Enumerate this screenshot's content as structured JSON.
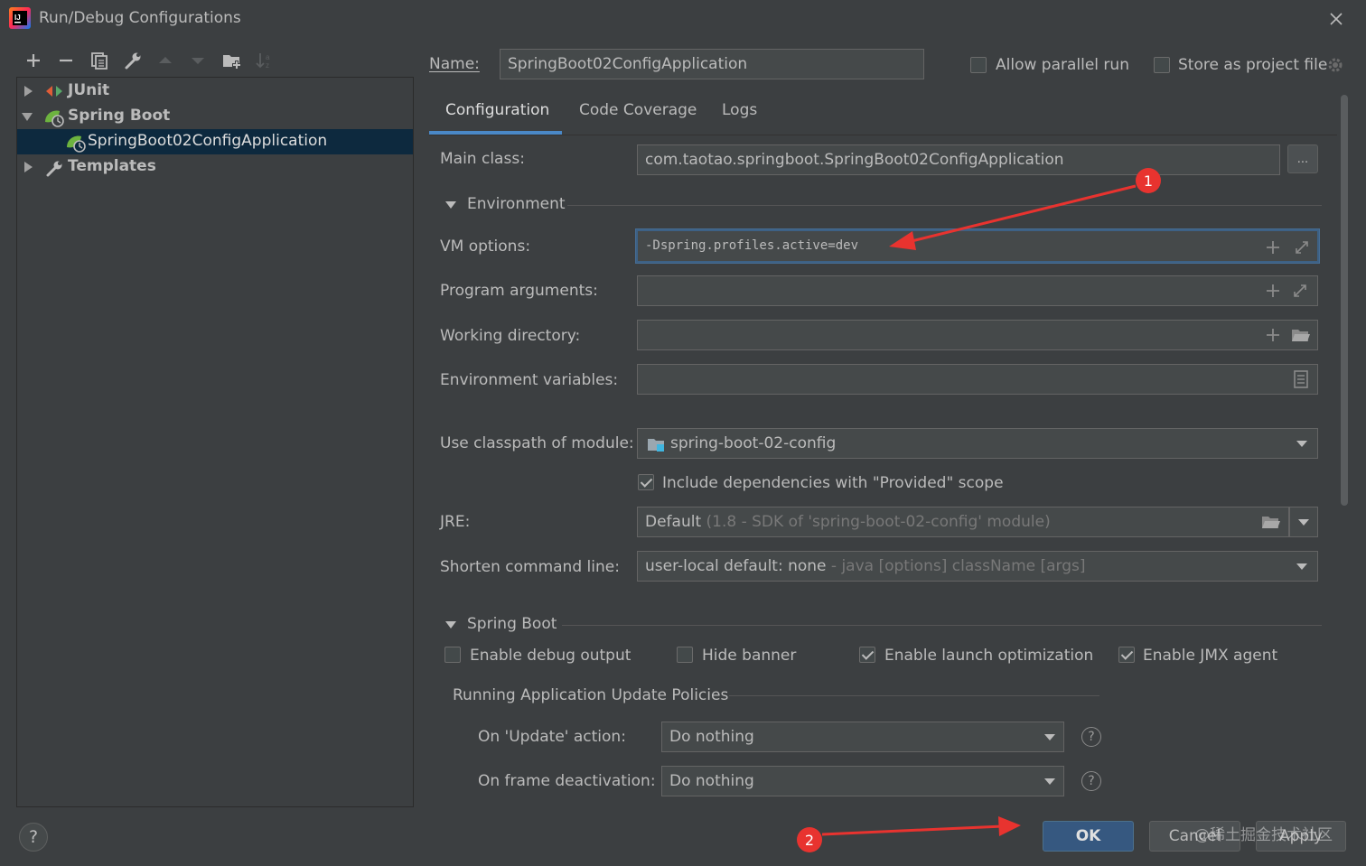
{
  "window": {
    "title": "Run/Debug Configurations"
  },
  "toolbar": {
    "icons": [
      "add-icon",
      "remove-icon",
      "copy-icon",
      "wrench-icon",
      "move-up-icon",
      "move-down-icon",
      "new-folder-icon",
      "sort-icon"
    ]
  },
  "tree": {
    "items": [
      {
        "label": "JUnit",
        "expanded": false
      },
      {
        "label": "Spring Boot",
        "expanded": true
      },
      {
        "label": "SpringBoot02ConfigApplication",
        "selected": true
      },
      {
        "label": "Templates",
        "expanded": false
      }
    ]
  },
  "header": {
    "name_label": "Name:",
    "name_value": "SpringBoot02ConfigApplication",
    "allow_parallel_label": "Allow parallel run",
    "allow_parallel_checked": false,
    "store_project_label": "Store as project file",
    "store_project_checked": false
  },
  "tabs": [
    {
      "label": "Configuration",
      "active": true
    },
    {
      "label": "Code Coverage",
      "active": false
    },
    {
      "label": "Logs",
      "active": false
    }
  ],
  "config": {
    "main_class_label": "Main class:",
    "main_class_value": "com.taotao.springboot.SpringBoot02ConfigApplication",
    "browse_label": "...",
    "environment_label": "Environment",
    "vm_options_label": "VM options:",
    "vm_options_value": "-Dspring.profiles.active=dev",
    "program_args_label": "Program arguments:",
    "program_args_value": "",
    "working_dir_label": "Working directory:",
    "working_dir_value": "",
    "env_vars_label": "Environment variables:",
    "env_vars_value": "",
    "classpath_label": "Use classpath of module:",
    "classpath_value": "spring-boot-02-config",
    "include_deps_label": "Include dependencies with \"Provided\" scope",
    "include_deps_checked": true,
    "jre_label": "JRE:",
    "jre_value": "Default",
    "jre_hint": "(1.8 - SDK of 'spring-boot-02-config' module)",
    "shorten_label": "Shorten command line:",
    "shorten_value": "user-local default: none",
    "shorten_hint": "- java [options] className [args]"
  },
  "spring_boot": {
    "section_label": "Spring Boot",
    "debug_output_label": "Enable debug output",
    "debug_output_checked": false,
    "hide_banner_label": "Hide banner",
    "hide_banner_checked": false,
    "launch_opt_label": "Enable launch optimization",
    "launch_opt_checked": true,
    "jmx_label": "Enable JMX agent",
    "jmx_checked": true,
    "policies_label": "Running Application Update Policies",
    "on_update_label": "On 'Update' action:",
    "on_update_value": "Do nothing",
    "on_frame_label": "On frame deactivation:",
    "on_frame_value": "Do nothing"
  },
  "footer": {
    "help_label": "?",
    "ok_label": "OK",
    "cancel_label": "Cancel",
    "apply_label": "Apply",
    "watermark": "@稀土掘金技术社区"
  },
  "annotations": {
    "badge1": "1",
    "badge2": "2",
    "arrow_color": "#e8332f"
  }
}
